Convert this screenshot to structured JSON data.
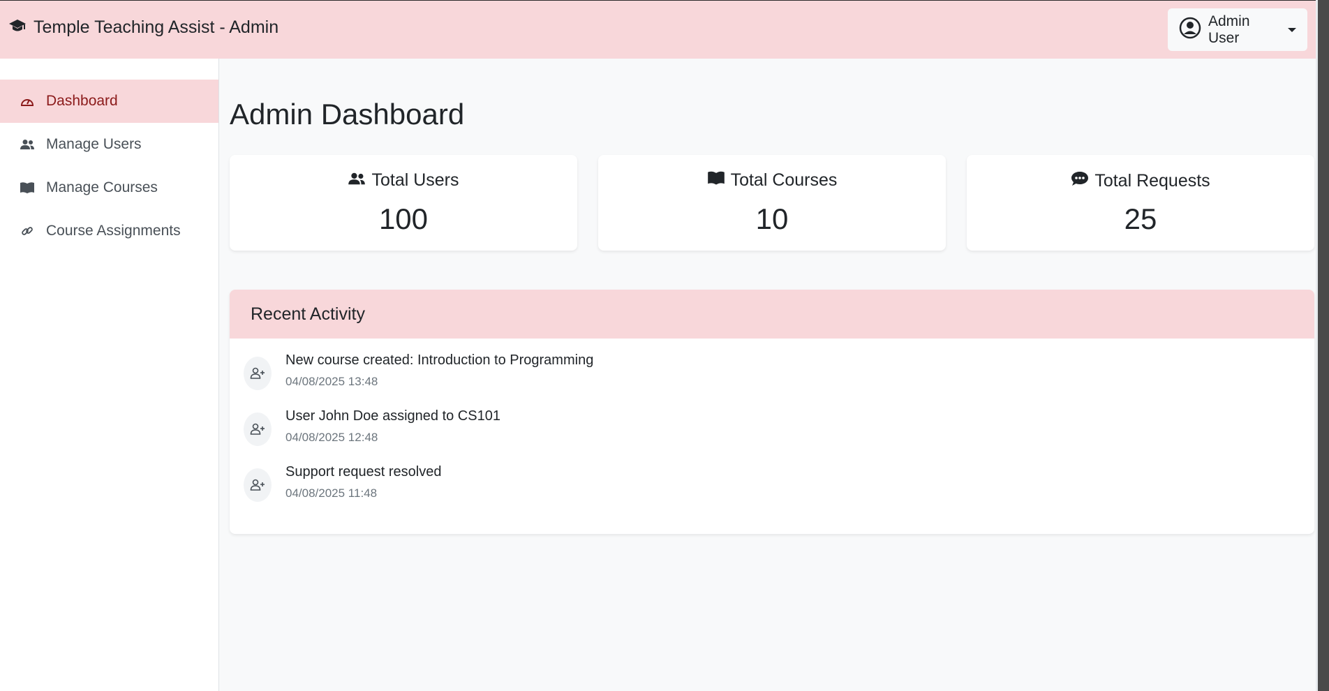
{
  "navbar": {
    "brand_icon": "graduation-cap-icon",
    "title": "Temple Teaching Assist - Admin",
    "user": {
      "icon": "user-circle-icon",
      "name": "Admin User"
    }
  },
  "sidebar": {
    "items": [
      {
        "label": "Dashboard",
        "icon": "gauge-icon",
        "active": true
      },
      {
        "label": "Manage Users",
        "icon": "users-icon",
        "active": false
      },
      {
        "label": "Manage Courses",
        "icon": "book-icon",
        "active": false
      },
      {
        "label": "Course Assignments",
        "icon": "link-icon",
        "active": false
      }
    ]
  },
  "main": {
    "title": "Admin Dashboard",
    "stats": [
      {
        "label": "Total Users",
        "value": "100",
        "icon": "users-icon"
      },
      {
        "label": "Total Courses",
        "value": "10",
        "icon": "book-icon"
      },
      {
        "label": "Total Requests",
        "value": "25",
        "icon": "comment-dots-icon"
      }
    ],
    "activity": {
      "title": "Recent Activity",
      "items": [
        {
          "text": "New course created: Introduction to Programming",
          "time": "04/08/2025 13:48",
          "icon": "user-plus-icon"
        },
        {
          "text": "User John Doe assigned to CS101",
          "time": "04/08/2025 12:48",
          "icon": "user-plus-icon"
        },
        {
          "text": "Support request resolved",
          "time": "04/08/2025 11:48",
          "icon": "user-plus-icon"
        }
      ]
    }
  },
  "colors": {
    "accent_pink": "#f8d7da",
    "active_text": "#8b1a1a",
    "background": "#f8f9fa"
  }
}
